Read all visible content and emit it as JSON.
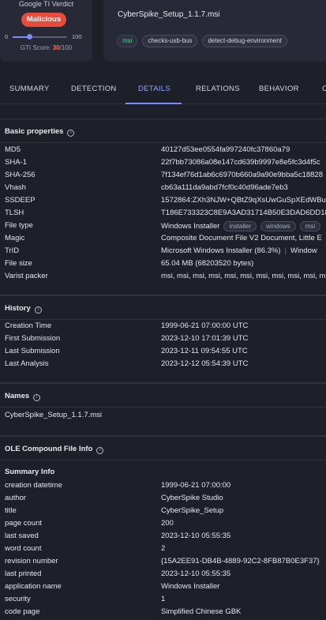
{
  "verdict": {
    "title": "Google TI Verdict",
    "badge": "Malicious",
    "scale_min": "0",
    "scale_max": "100",
    "score": 30,
    "score_max": 100,
    "score_label": "GTI Score:",
    "score_value": "30",
    "score_suffix": "/100",
    "accent": "#e84a3c"
  },
  "file": {
    "name": "CyberSpike_Setup_1.1.7.msi",
    "tags": [
      "msi",
      "checks-usb-bus",
      "detect-debug-environment"
    ]
  },
  "tabs": [
    "SUMMARY",
    "DETECTION",
    "DETAILS",
    "RELATIONS",
    "BEHAVIOR",
    "C"
  ],
  "active_tab": "DETAILS",
  "basic": {
    "title": "Basic properties",
    "rows": [
      {
        "k": "MD5",
        "v": "40127d53ee0554fa997240fc37860a79"
      },
      {
        "k": "SHA-1",
        "v": "22f7bb73086a08e147cd639b9997e8e5fc3d4f5c"
      },
      {
        "k": "SHA-256",
        "v": "7f134ef76d1ab6c6970b660a9a90e9bba5c18828"
      },
      {
        "k": "Vhash",
        "v": "cb63a111da9abd7fcf0c40d96ade7eb3"
      },
      {
        "k": "SSDEEP",
        "v": "1572864:ZXh3NJW+QBtZ9qXsUwGuSpXEdWBuG"
      },
      {
        "k": "TLSH",
        "v": "T186E733323C8E9A3AD31714B50E3DAD6DD18"
      },
      {
        "k": "File type",
        "v": "Windows Installer",
        "pills": [
          "installer",
          "windows",
          "msi"
        ]
      },
      {
        "k": "Magic",
        "v": "Composite Document File V2 Document, Little E"
      },
      {
        "k": "TrID",
        "v": "Microsoft Windows Installer (86.3%)",
        "extra": "Window"
      },
      {
        "k": "File size",
        "v": "65.04 MB (68203520 bytes)"
      },
      {
        "k": "Varist packer",
        "v": "msi, msi, msi, msi, msi, msi, msi, msi, msi, msi, m"
      }
    ]
  },
  "history": {
    "title": "History",
    "rows": [
      {
        "k": "Creation Time",
        "v": "1999-06-21 07:00:00 UTC"
      },
      {
        "k": "First Submission",
        "v": "2023-12-10 17:01:39 UTC"
      },
      {
        "k": "Last Submission",
        "v": "2023-12-11 09:54:55 UTC"
      },
      {
        "k": "Last Analysis",
        "v": "2023-12-12 05:54:39 UTC"
      }
    ]
  },
  "names": {
    "title": "Names",
    "items": [
      "CyberSpike_Setup_1.1.7.msi"
    ]
  },
  "ole": {
    "title": "OLE Compound File Info",
    "subtitle": "Summary Info",
    "rows": [
      {
        "k": "creation datetime",
        "v": "1999-06-21 07:00:00"
      },
      {
        "k": "author",
        "v": "CyberSpike Studio"
      },
      {
        "k": "title",
        "v": "CyberSpike_Setup"
      },
      {
        "k": "page count",
        "v": "200"
      },
      {
        "k": "last saved",
        "v": "2023-12-10 05:55:35"
      },
      {
        "k": "word count",
        "v": "2"
      },
      {
        "k": "revision number",
        "v": "{15A2EE91-DB4B-4889-92C2-8FB87B0E3F37}"
      },
      {
        "k": "last printed",
        "v": "2023-12-10 05:55:35"
      },
      {
        "k": "application name",
        "v": "Windows Installer"
      },
      {
        "k": "security",
        "v": "1"
      },
      {
        "k": "code page",
        "v": "Simplified Chinese GBK"
      }
    ]
  }
}
